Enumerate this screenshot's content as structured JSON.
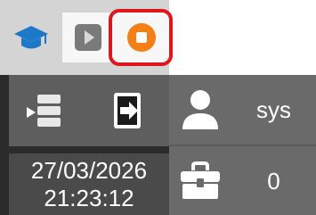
{
  "toolbar": {
    "home_icon": "graduation-cap-icon",
    "play_icon": "play-icon",
    "stop_icon": "stop-record-icon",
    "colors": {
      "home": "#1e78c8",
      "play": "#7a7a7a",
      "stop": "#f57f17",
      "highlight": "#e0161d"
    }
  },
  "left_panel": {
    "list_icon": "list-pointer-icon",
    "exit_icon": "exit-door-icon",
    "date": "27/03/2026",
    "time": "21:23:12"
  },
  "right_panel": {
    "user": {
      "icon": "user-icon",
      "value": "sys"
    },
    "case": {
      "icon": "briefcase-icon",
      "value": "0"
    }
  }
}
